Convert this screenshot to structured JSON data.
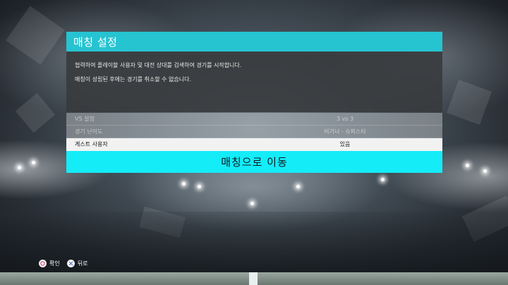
{
  "dialog": {
    "title": "매칭 설정",
    "description": [
      "협력하여 플레이할 사용자 및 대전 상대를 검색하여 경기를 시작합니다.",
      "매칭이 성립된 후에는 경기를 취소할 수 없습니다."
    ],
    "settings": [
      {
        "label": "VS 설정",
        "value": "3 vs 3",
        "state": "disabled"
      },
      {
        "label": "경기 난이도",
        "value": "비기너 - 슈퍼스타",
        "state": "disabled"
      },
      {
        "label": "게스트 사용자",
        "value": "있음",
        "state": "selected"
      }
    ],
    "action_label": "매칭으로 이동"
  },
  "footer": {
    "confirm": {
      "icon": "circle-button-icon",
      "label": "확인"
    },
    "back": {
      "icon": "cross-button-icon",
      "label": "뒤로"
    }
  },
  "colors": {
    "title_bar": "#26c3d1",
    "action_button": "#14ecf8",
    "selected_row": "#f2f2f2"
  }
}
